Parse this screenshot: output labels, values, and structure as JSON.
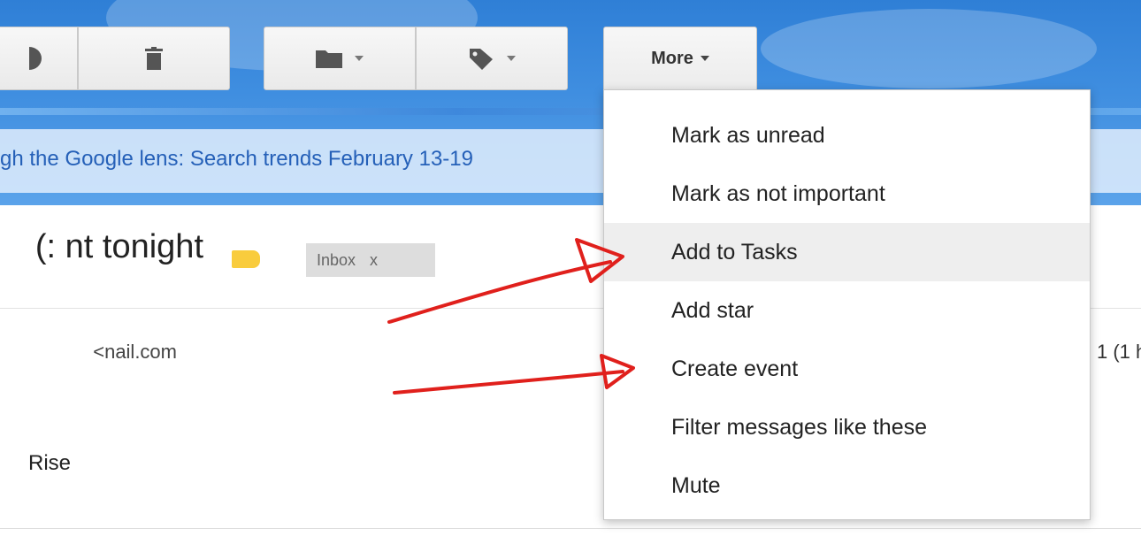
{
  "toolbar": {
    "more_label": "More",
    "icons": [
      "archive-icon",
      "delete-icon",
      "move-to-folder-icon",
      "labels-icon",
      "chevron-down-icon"
    ]
  },
  "search_link": {
    "text": "gh the Google lens: Search trends February 13-19"
  },
  "thread": {
    "subject": "nt tonight :)",
    "label_chip": "Inbox",
    "label_chip_close": "x",
    "sender": "nail.com>",
    "date_fragment": "1 (1 h",
    "snippet": "Rise"
  },
  "more_menu": {
    "items": [
      {
        "label": "Mark as unread"
      },
      {
        "label": "Mark as not important"
      },
      {
        "label": "Add to Tasks"
      },
      {
        "label": "Add star"
      },
      {
        "label": "Create event"
      },
      {
        "label": "Filter messages like these"
      },
      {
        "label": "Mute"
      }
    ],
    "highlighted_index": 2
  },
  "colors": {
    "header_blue": "#3f8ee0",
    "link_blue": "#2560b8",
    "label_yellow": "#f9cc3d",
    "annotation_red": "#e0201c"
  }
}
